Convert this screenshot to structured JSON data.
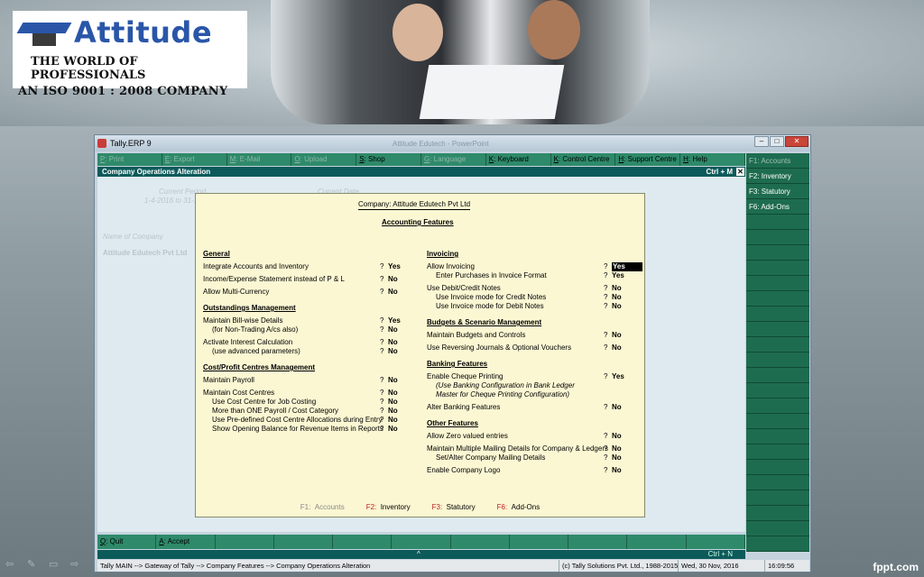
{
  "logo": {
    "name": "Attitude",
    "tagline": "THE WORLD OF PROFESSIONALS",
    "iso": "AN ISO 9001 : 2008 COMPANY"
  },
  "window": {
    "title": "Tally.ERP 9",
    "ghost_title": "Attitude Edutech - PowerPoint",
    "controls": [
      "–",
      "□",
      "✕"
    ]
  },
  "menu": [
    {
      "key": "P",
      "label": ": Print",
      "enabled": false
    },
    {
      "key": "E",
      "label": ": Export",
      "enabled": false
    },
    {
      "key": "M",
      "label": ": E-Mail",
      "enabled": false
    },
    {
      "key": "O",
      "label": ": Upload",
      "enabled": false
    },
    {
      "key": "S",
      "label": ": Shop",
      "enabled": true
    },
    {
      "key": "G",
      "label": ": Language",
      "enabled": false
    },
    {
      "key": "K",
      "label": ": Keyboard",
      "enabled": true
    },
    {
      "key": "K",
      "label": ": Control Centre",
      "enabled": true
    },
    {
      "key": "H",
      "label": ": Support Centre",
      "enabled": true
    },
    {
      "key": "H",
      "label": ": Help",
      "enabled": true
    }
  ],
  "header": {
    "title": "Company Operations  Alteration",
    "shortcut": "Ctrl + M",
    "close": "✕"
  },
  "background_form": {
    "current_period_label": "Current Period",
    "current_period_value": "1-4-2016 to 31-3-2017",
    "current_date_label": "Current Date",
    "name_label": "Name of Company",
    "name_value": "Attitude Edutech Pvt Ltd"
  },
  "right_panel": [
    {
      "label": "F1: Accounts",
      "enabled": false
    },
    {
      "label": "F2: Inventory",
      "enabled": true
    },
    {
      "label": "F3: Statutory",
      "enabled": true
    },
    {
      "label": "F6: Add-Ons",
      "enabled": true
    }
  ],
  "dialog": {
    "company": "Company:  Attitude Edutech Pvt Ltd",
    "heading": "Accounting Features",
    "left": [
      {
        "section": "General",
        "rows": [
          {
            "label": "Integrate Accounts and Inventory",
            "value": "Yes"
          },
          {
            "label": "Income/Expense Statement instead of P & L",
            "value": "No",
            "gap": true
          },
          {
            "label": "Allow Multi-Currency",
            "value": "No",
            "gap": true
          }
        ]
      },
      {
        "section": "Outstandings Management",
        "rows": [
          {
            "label": "Maintain Bill-wise Details",
            "value": "Yes"
          },
          {
            "label": "(for Non-Trading A/cs also)",
            "value": "No",
            "indent": true
          },
          {
            "label": "Activate Interest Calculation",
            "value": "No",
            "gap": true
          },
          {
            "label": "(use advanced parameters)",
            "value": "No",
            "indent": true
          }
        ]
      },
      {
        "section": "Cost/Profit Centres Management",
        "rows": [
          {
            "label": "Maintain Payroll",
            "value": "No"
          },
          {
            "label": "Maintain Cost Centres",
            "value": "No",
            "gap": true
          },
          {
            "label": "Use Cost Centre for Job Costing",
            "value": "No",
            "indent": true
          },
          {
            "label": "More than ONE Payroll / Cost Category",
            "value": "No",
            "indent": true
          },
          {
            "label": "Use Pre-defined Cost Centre Allocations during Entry",
            "value": "No",
            "indent": true
          },
          {
            "label": "Show Opening Balance for Revenue Items in Reports",
            "value": "No",
            "indent": true
          }
        ]
      }
    ],
    "right": [
      {
        "section": "Invoicing",
        "rows": [
          {
            "label": "Allow Invoicing",
            "value": "Yes",
            "selected": true
          },
          {
            "label": "Enter Purchases in Invoice Format",
            "value": "Yes",
            "indent": true
          },
          {
            "label": "Use Debit/Credit Notes",
            "value": "No",
            "gap": true
          },
          {
            "label": "Use Invoice mode for Credit Notes",
            "value": "No",
            "indent": true
          },
          {
            "label": "Use Invoice mode for Debit Notes",
            "value": "No",
            "indent": true
          }
        ]
      },
      {
        "section": "Budgets & Scenario Management",
        "rows": [
          {
            "label": "Maintain Budgets and Controls",
            "value": "No"
          },
          {
            "label": "Use Reversing Journals & Optional Vouchers",
            "value": "No",
            "gap": true
          }
        ]
      },
      {
        "section": "Banking Features",
        "rows": [
          {
            "label": "Enable Cheque Printing",
            "value": "Yes"
          },
          {
            "label": "(Use Banking Configuration in Bank Ledger",
            "value": "",
            "italic": true
          },
          {
            "label": "Master for Cheque Printing Configuration)",
            "value": "",
            "italic": true
          },
          {
            "label": "Alter Banking Features",
            "value": "No",
            "gap": true
          }
        ]
      },
      {
        "section": "Other Features",
        "rows": [
          {
            "label": "Allow Zero valued entries",
            "value": "No"
          },
          {
            "label": "Maintain Multiple Mailing Details for Company & Ledgers",
            "value": "No",
            "gap": true
          },
          {
            "label": "Set/Alter Company Mailing Details",
            "value": "No",
            "indent": true
          },
          {
            "label": "Enable Company Logo",
            "value": "No",
            "gap": true
          }
        ]
      }
    ],
    "footer": [
      {
        "key": "F1:",
        "label": "Accounts",
        "enabled": false
      },
      {
        "key": "F2:",
        "label": "Inventory",
        "enabled": true
      },
      {
        "key": "F3:",
        "label": "Statutory",
        "enabled": true
      },
      {
        "key": "F6:",
        "label": "Add-Ons",
        "enabled": true
      }
    ]
  },
  "bottom": [
    {
      "key": "Q",
      "label": ": Quit"
    },
    {
      "key": "A",
      "label": ": Accept"
    },
    {
      "key": "",
      "label": ""
    },
    {
      "key": "",
      "label": ""
    },
    {
      "key": "",
      "label": ""
    },
    {
      "key": "",
      "label": ""
    },
    {
      "key": "",
      "label": ""
    },
    {
      "key": "",
      "label": ""
    },
    {
      "key": "",
      "label": ""
    },
    {
      "key": "",
      "label": ""
    },
    {
      "key": "",
      "label": ""
    }
  ],
  "midbar": {
    "caret": "^",
    "shortcut": "Ctrl + N"
  },
  "status": {
    "path": "Tally MAIN --> Gateway of Tally --> Company Features --> Company Operations  Alteration",
    "copyright": "(c) Tally Solutions Pvt. Ltd., 1988-2015",
    "date": "Wed, 30 Nov, 2016",
    "time": "16:09:56"
  },
  "watermark": "fppt.com"
}
